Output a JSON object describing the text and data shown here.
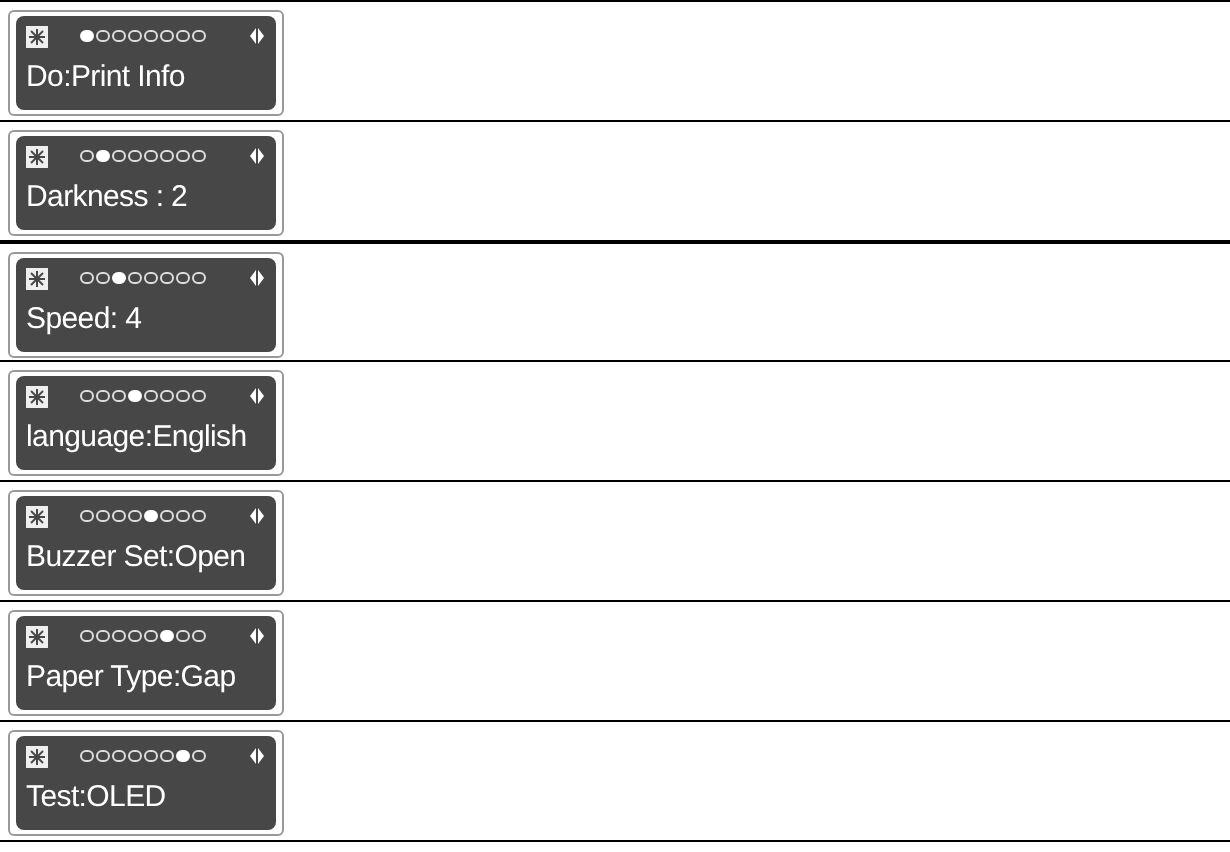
{
  "screens": [
    {
      "label": "Do:Print Info",
      "indicators": [
        {
          "selected": true
        },
        {
          "selected": false
        },
        {
          "selected": false
        },
        {
          "selected": false
        },
        {
          "selected": false
        },
        {
          "selected": false
        },
        {
          "selected": false
        },
        {
          "selected": false
        }
      ]
    },
    {
      "label": "Darkness : 2",
      "indicators": [
        {
          "selected": false
        },
        {
          "selected": true
        },
        {
          "selected": false
        },
        {
          "selected": false
        },
        {
          "selected": false
        },
        {
          "selected": false
        },
        {
          "selected": false
        },
        {
          "selected": false
        }
      ]
    },
    {
      "label": "Speed: 4",
      "indicators": [
        {
          "selected": false
        },
        {
          "selected": false
        },
        {
          "selected": true
        },
        {
          "selected": false
        },
        {
          "selected": false
        },
        {
          "selected": false
        },
        {
          "selected": false
        },
        {
          "selected": false
        }
      ]
    },
    {
      "label": "language:English",
      "indicators": [
        {
          "selected": false
        },
        {
          "selected": false
        },
        {
          "selected": false
        },
        {
          "selected": true
        },
        {
          "selected": false
        },
        {
          "selected": false
        },
        {
          "selected": false
        },
        {
          "selected": false
        }
      ]
    },
    {
      "label": "Buzzer Set:Open",
      "indicators": [
        {
          "selected": false
        },
        {
          "selected": false
        },
        {
          "selected": false
        },
        {
          "selected": false
        },
        {
          "selected": true
        },
        {
          "selected": false
        },
        {
          "selected": false
        },
        {
          "selected": false
        }
      ]
    },
    {
      "label": "Paper Type:Gap",
      "indicators": [
        {
          "selected": false
        },
        {
          "selected": false
        },
        {
          "selected": false
        },
        {
          "selected": false
        },
        {
          "selected": false
        },
        {
          "selected": true
        },
        {
          "selected": false
        },
        {
          "selected": false
        }
      ]
    },
    {
      "label": "Test:OLED",
      "indicators": [
        {
          "selected": false
        },
        {
          "selected": false
        },
        {
          "selected": false
        },
        {
          "selected": false
        },
        {
          "selected": false
        },
        {
          "selected": false
        },
        {
          "selected": true
        },
        {
          "selected": false
        }
      ]
    }
  ]
}
